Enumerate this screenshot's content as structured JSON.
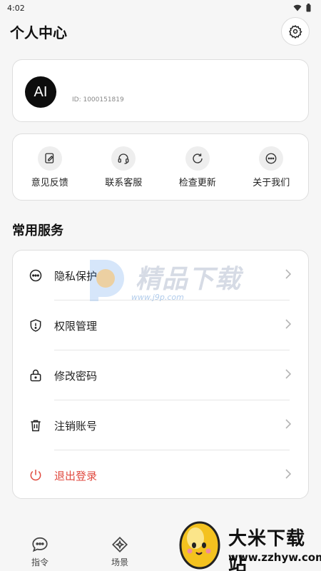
{
  "status_bar": {
    "time": "4:02"
  },
  "header": {
    "title": "个人中心"
  },
  "profile": {
    "avatar_text": "AI",
    "user_id": "ID: 1000151819"
  },
  "quick_actions": [
    {
      "label": "意见反馈",
      "icon": "feedback-edit-icon"
    },
    {
      "label": "联系客服",
      "icon": "headset-icon"
    },
    {
      "label": "检查更新",
      "icon": "refresh-icon"
    },
    {
      "label": "关于我们",
      "icon": "more-dots-icon"
    }
  ],
  "services": {
    "title": "常用服务",
    "items": [
      {
        "label": "隐私保护",
        "icon": "privacy-dots-icon"
      },
      {
        "label": "权限管理",
        "icon": "shield-icon"
      },
      {
        "label": "修改密码",
        "icon": "lock-icon"
      },
      {
        "label": "注销账号",
        "icon": "trash-icon"
      },
      {
        "label": "退出登录",
        "icon": "power-icon"
      }
    ]
  },
  "watermark": {
    "title": "精品下载",
    "url": "www.j9p.com"
  },
  "bottom_nav": [
    {
      "label": "指令",
      "icon": "chat-bubble-icon"
    },
    {
      "label": "场景",
      "icon": "sparkle-diamond-icon"
    }
  ],
  "brand_badge": {
    "name": "大米下载站",
    "url": "www.zzhyw.com"
  },
  "colors": {
    "danger": "#e04a3f",
    "background": "#f6f6f6",
    "card": "#ffffff"
  }
}
